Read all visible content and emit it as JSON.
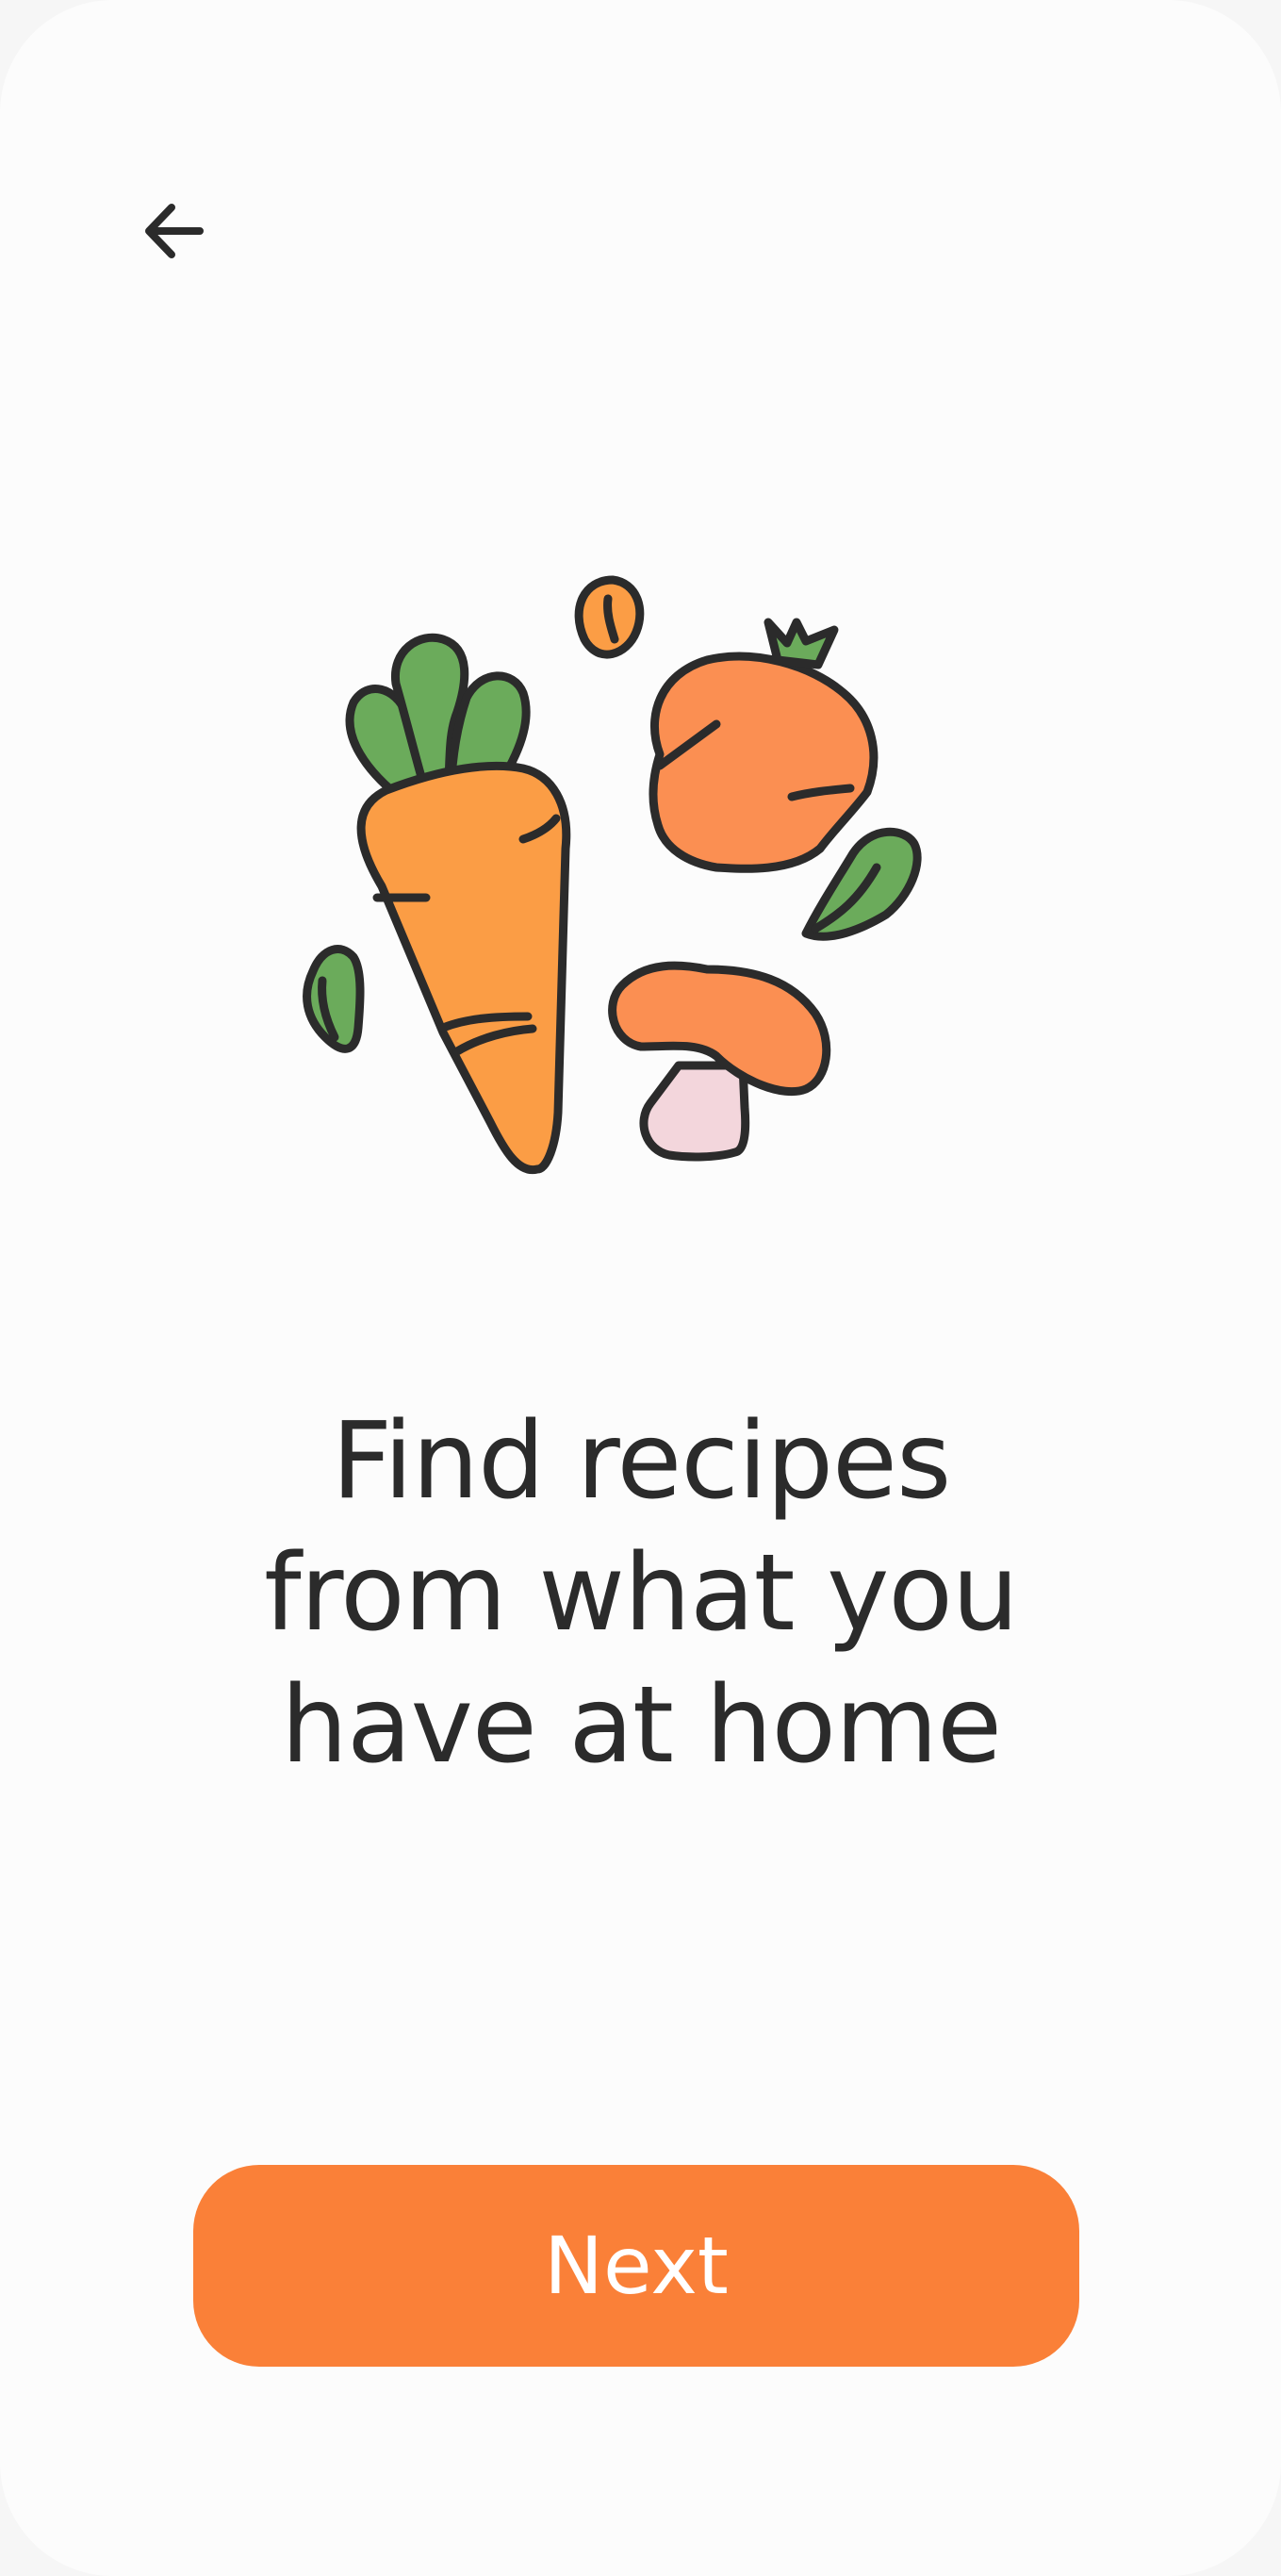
{
  "nav": {
    "back_icon": "arrow-left-icon"
  },
  "illustration": {
    "icon": "vegetables-illustration",
    "colors": {
      "carrot": "#fb9d45",
      "tomato": "#fb8f52",
      "leaf": "#6bab5b",
      "mushroom_stem": "#f3d6dc",
      "outline": "#2b2b2b"
    }
  },
  "headline": {
    "line1": "Find recipes",
    "line2": "from what you",
    "line3": "have at home"
  },
  "actions": {
    "next_label": "Next",
    "accent_color": "#fa8038"
  }
}
